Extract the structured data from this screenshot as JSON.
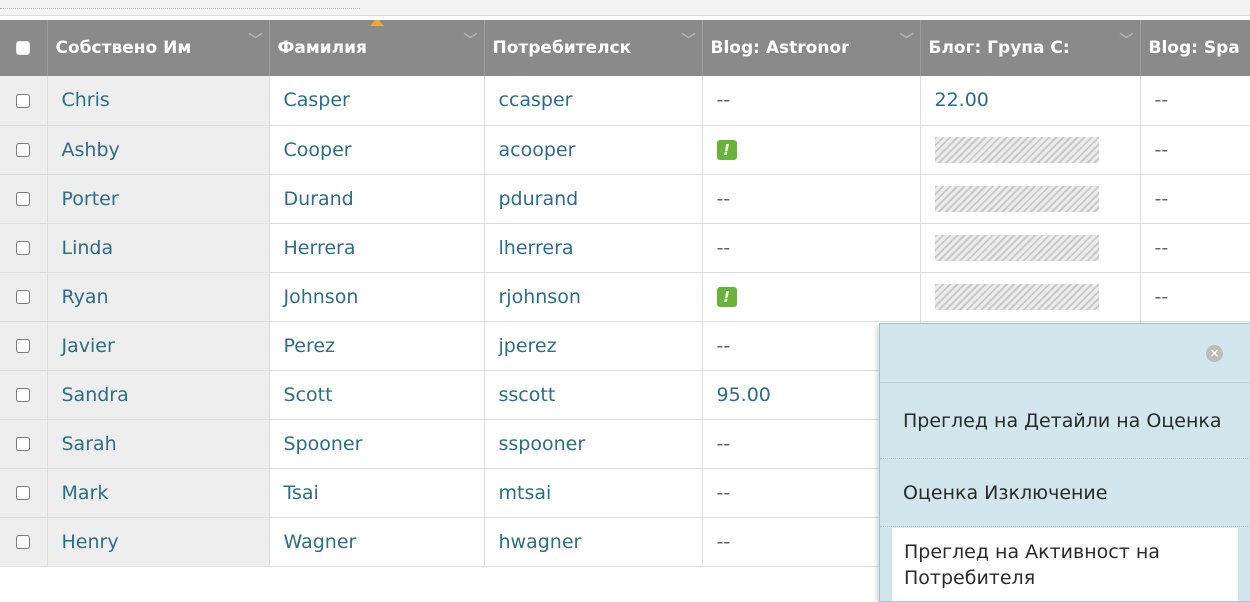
{
  "columns": {
    "first_name": "Собствено Им",
    "last_name": "Фамилия",
    "username": "Потребителск",
    "blog_astronomy": "Blog: Astronor",
    "blog_group": "Блог: Група С:",
    "blog_spa": "Blog: Spa"
  },
  "rows": [
    {
      "first": "Chris",
      "last": "Casper",
      "user": "ccasper",
      "astro": "--",
      "group": "22.00",
      "spa": "--"
    },
    {
      "first": "Ashby",
      "last": "Cooper",
      "user": "acooper",
      "astro": "",
      "group": "",
      "spa": "--"
    },
    {
      "first": "Porter",
      "last": "Durand",
      "user": "pdurand",
      "astro": "--",
      "group": "",
      "spa": "--"
    },
    {
      "first": "Linda",
      "last": "Herrera",
      "user": "lherrera",
      "astro": "--",
      "group": "",
      "spa": "--"
    },
    {
      "first": "Ryan",
      "last": "Johnson",
      "user": "rjohnson",
      "astro": "",
      "group": "",
      "spa": "--"
    },
    {
      "first": "Javier",
      "last": "Perez",
      "user": "jperez",
      "astro": "--",
      "group": "",
      "spa": ""
    },
    {
      "first": "Sandra",
      "last": "Scott",
      "user": "sscott",
      "astro": "95.00",
      "group": "",
      "spa": ""
    },
    {
      "first": "Sarah",
      "last": "Spooner",
      "user": "sspooner",
      "astro": "--",
      "group": "",
      "spa": ""
    },
    {
      "first": "Mark",
      "last": "Tsai",
      "user": "mtsai",
      "astro": "--",
      "group": "",
      "spa": ""
    },
    {
      "first": "Henry",
      "last": "Wagner",
      "user": "hwagner",
      "astro": "--",
      "group": "",
      "spa": ""
    }
  ],
  "context_menu": {
    "item_view_grade_details": "Преглед на Детайли на Оценка",
    "item_exempt_grade": "Оценка Изключение",
    "item_view_user_activity": "Преглед на Активност на Потребителя"
  },
  "icons": {
    "attention": "needs-grading-icon",
    "exclamation_glyph": "!",
    "close": "close-icon",
    "close_glyph": "×",
    "chevron": "chevron-down-icon",
    "chevron_glyph": "﹀"
  },
  "colors": {
    "header_bg": "#8a8a8a",
    "link_text": "#2b6f86",
    "attention_green": "#6ab33a",
    "menu_bg": "#d2e6ee",
    "sort_arrow": "#f0a830"
  }
}
